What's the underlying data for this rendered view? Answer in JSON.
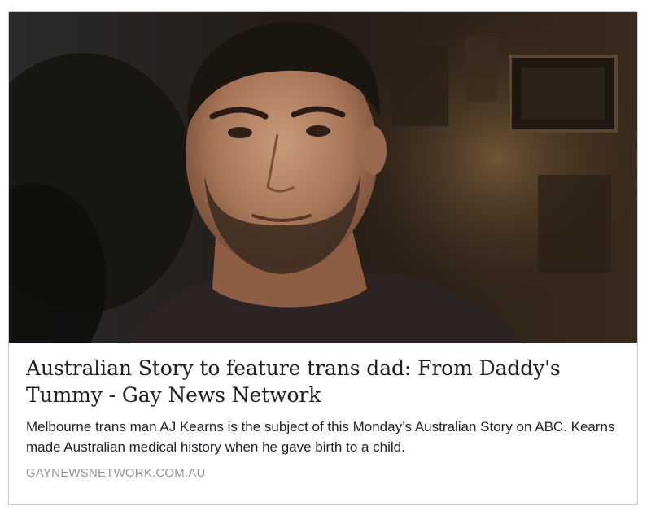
{
  "link_preview": {
    "image_alt": "",
    "title": "Australian Story to feature trans dad: From Daddy's Tummy - Gay News Network",
    "description": "Melbourne trans man AJ Kearns is the subject of this Monday’s Australian Story on ABC. Kearns made Australian medical history when he gave birth to a child.",
    "domain": "GAYNEWSNETWORK.COM.AU"
  },
  "colors": {
    "card_border": "#c8ccd2",
    "title_text": "#1c1e21",
    "description_text": "#1d2129",
    "domain_text": "#90949c"
  }
}
